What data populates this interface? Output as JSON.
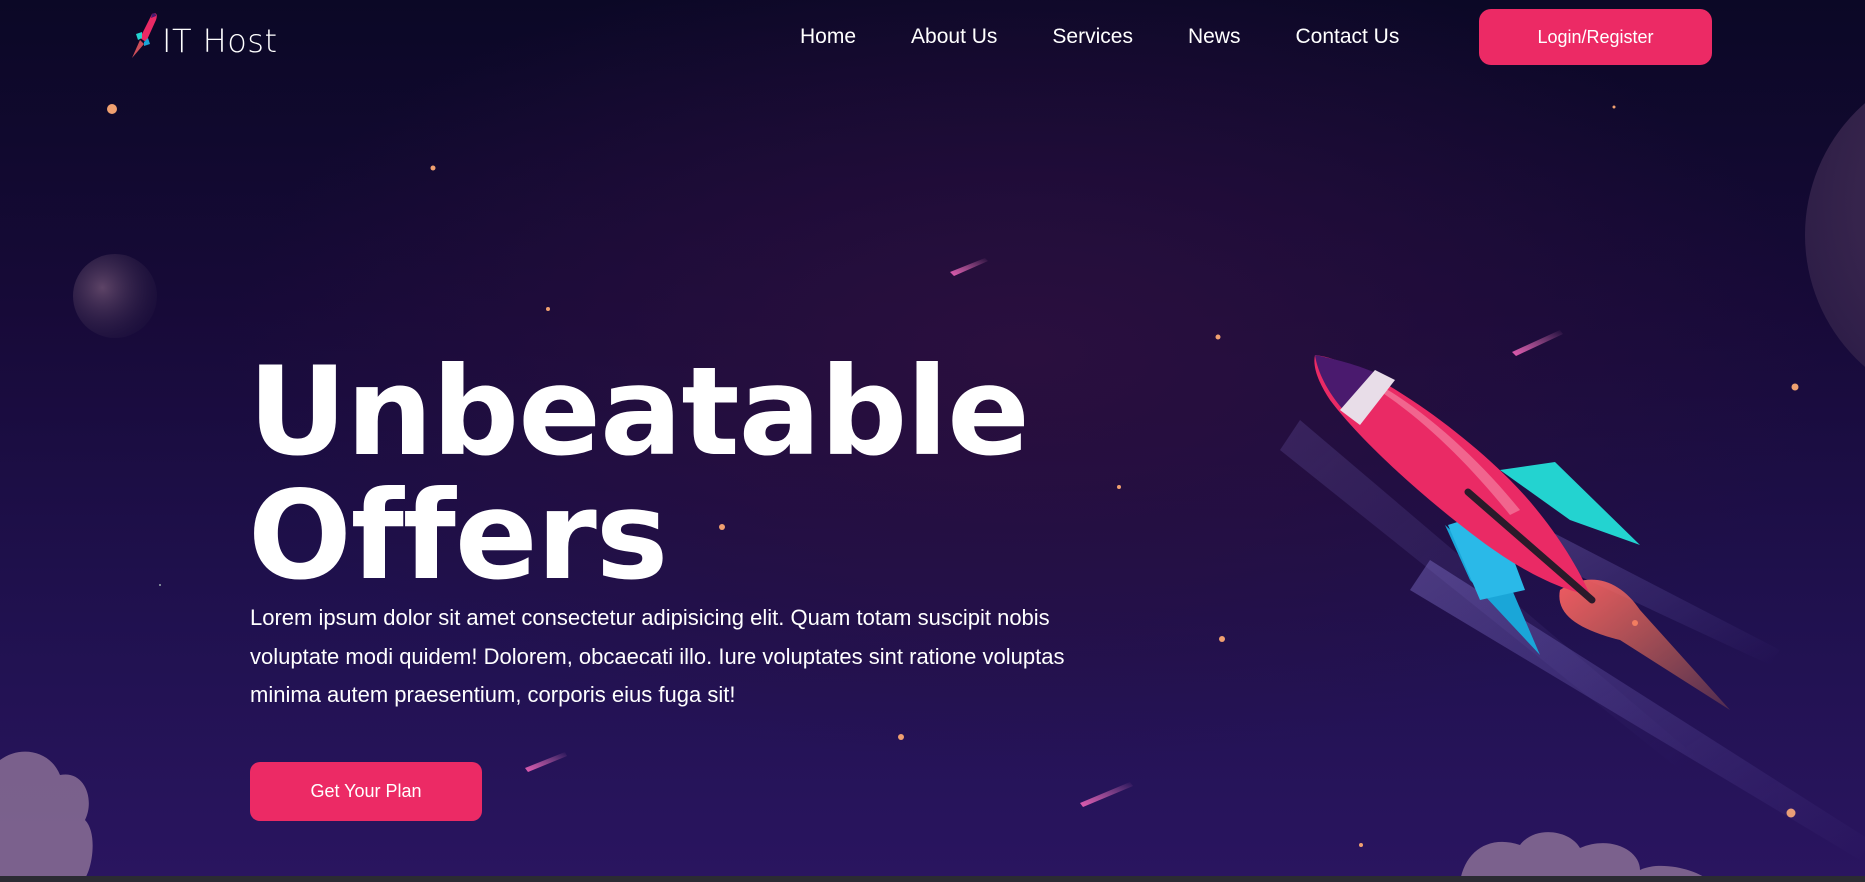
{
  "brand": {
    "name": "IT Host",
    "logo_icon": "rocket-icon"
  },
  "nav": {
    "items": [
      "Home",
      "About Us",
      "Services",
      "News",
      "Contact Us"
    ],
    "login_label": "Login/Register"
  },
  "hero": {
    "title_line1": "Unbeatable",
    "title_line2": "Offers",
    "description": "Lorem ipsum dolor sit amet consectetur adipisicing elit. Quam totam suscipit nobis voluptate modi quidem! Dolorem, obcaecati illo. Iure voluptates sint ratione voluptas minima autem praesentium, corporis eius fuga sit!",
    "cta_label": "Get Your Plan",
    "illustration_icon": "rocket-icon"
  },
  "colors": {
    "accent": "#ec2a65",
    "background_top": "#0b0826",
    "background_bottom": "#2a1560",
    "text": "#ffffff"
  }
}
